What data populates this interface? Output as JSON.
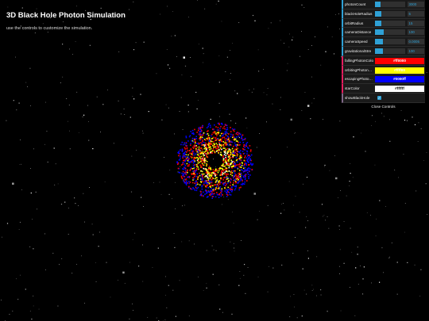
{
  "header": {
    "title": "3D Black Hole Photon Simulation",
    "subtitle": "use the controls to customize the simulation."
  },
  "controls": {
    "numeric": [
      {
        "label": "photonCount",
        "value": "3000",
        "fill": 0.18
      },
      {
        "label": "blackHoleRadius",
        "value": "5",
        "fill": 0.2
      },
      {
        "label": "orbitRadius",
        "value": "15",
        "fill": 0.2
      },
      {
        "label": "cameraDistance",
        "value": "100",
        "fill": 0.3
      },
      {
        "label": "cameraSpeed",
        "value": "0.0005",
        "fill": 0.25
      },
      {
        "label": "gravitationalStre",
        "value": "100",
        "fill": 0.25
      }
    ],
    "colors": [
      {
        "label": "fallingPhotonColo",
        "value": "#ff0000",
        "hex": "#ff0000",
        "text": "#ffffff"
      },
      {
        "label": "orbitingPhotonC...",
        "value": "#ffff00",
        "hex": "#ffff00",
        "text": "#ffffff"
      },
      {
        "label": "escapingPhoton...",
        "value": "#0000ff",
        "hex": "#0000ff",
        "text": "#ffffff"
      },
      {
        "label": "starColor",
        "value": "#ffffff",
        "hex": "#ffffff",
        "text": "#000000"
      }
    ],
    "toggle": {
      "label": "showBlackHole",
      "checked": true,
      "mark": "✓"
    },
    "close_label": "Close Controls"
  },
  "photon_colors": {
    "falling": "#ff0000",
    "orbiting": "#ffff00",
    "escaping": "#0000ff",
    "star": "#ffffff"
  }
}
